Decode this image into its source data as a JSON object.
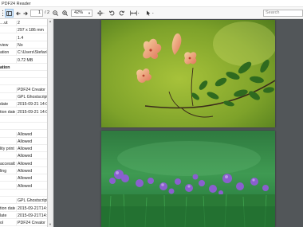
{
  "window": {
    "title": "PDF24 Reader"
  },
  "toolbar": {
    "current_page": "1",
    "total_pages": "/ 2",
    "zoom": "42%",
    "search_placeholder": "Search"
  },
  "properties": [
    {
      "key": "…ut",
      "value": "2"
    },
    {
      "key": "",
      "value": "297 x 186 mm"
    },
    {
      "key": "",
      "value": "1.4"
    },
    {
      "key": "view",
      "value": "No"
    },
    {
      "key": "ation",
      "value": "C:\\Users\\Stefan\\D..."
    },
    {
      "key": "",
      "value": "0.72 MB"
    },
    {
      "key": "ation",
      "value": "",
      "header": true
    },
    {
      "key": "",
      "value": ""
    },
    {
      "key": "",
      "value": ""
    },
    {
      "key": "",
      "value": "PDF24 Creator"
    },
    {
      "key": "",
      "value": "GPL Ghostscript 9..."
    },
    {
      "key": "date",
      "value": "2015-09-21 14:0..."
    },
    {
      "key": "tion date",
      "value": "2015-09-21 14:0..."
    },
    {
      "key": "",
      "value": ""
    },
    {
      "key": "",
      "value": ""
    },
    {
      "key": "",
      "value": "Allowed"
    },
    {
      "key": "",
      "value": "Allowed"
    },
    {
      "key": "lity print",
      "value": "Allowed"
    },
    {
      "key": "",
      "value": "Allowed"
    },
    {
      "key": "accessibl",
      "value": "Allowed"
    },
    {
      "key": "ling",
      "value": "Allowed"
    },
    {
      "key": "",
      "value": "Allowed"
    },
    {
      "key": "",
      "value": "Allowed"
    },
    {
      "key": "",
      "value": ""
    },
    {
      "key": "",
      "value": "GPL Ghostscript 9..."
    },
    {
      "key": "tion date",
      "value": "2015-09-21T14:12..."
    },
    {
      "key": "late",
      "value": "2015-09-21T14:12..."
    },
    {
      "key": "ol",
      "value": "PDF24 Creator"
    }
  ],
  "colors": {
    "viewer_bg": "#525659",
    "toolbar_bg": "#f7f7f7",
    "selected_tool": "#cfe3f6"
  },
  "icons": [
    "sidebar-toggle-icon",
    "back-arrow-icon",
    "forward-arrow-icon",
    "zoom-out-icon",
    "zoom-in-icon",
    "pan-icon",
    "undo-icon",
    "redo-icon",
    "fit-width-icon",
    "pointer-icon"
  ]
}
